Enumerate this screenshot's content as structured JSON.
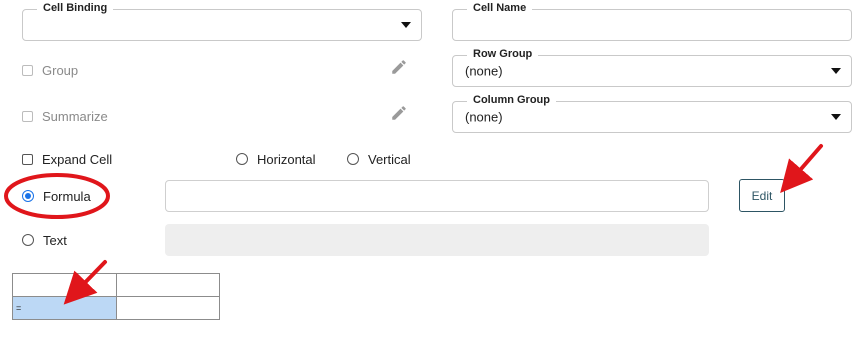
{
  "cell_binding": {
    "label": "Cell Binding",
    "value": ""
  },
  "cell_name": {
    "label": "Cell Name",
    "value": ""
  },
  "row_group": {
    "label": "Row Group",
    "value": "(none)"
  },
  "column_group": {
    "label": "Column Group",
    "value": "(none)"
  },
  "options": {
    "group_label": "Group",
    "summarize_label": "Summarize",
    "expand_cell_label": "Expand Cell",
    "horizontal_label": "Horizontal",
    "vertical_label": "Vertical"
  },
  "formula": {
    "label": "Formula",
    "value": "",
    "selected": true,
    "edit_label": "Edit"
  },
  "text": {
    "label": "Text",
    "value": ""
  },
  "mini_grid": {
    "rows": [
      [
        "",
        ""
      ],
      [
        "=",
        ""
      ]
    ],
    "selected_cell": "row 2, column 1"
  },
  "colors": {
    "accent": "#1a73e8",
    "annotation_red": "#e0161b",
    "selected_cell": "#bcd8f5",
    "edit_button": "#2d5564"
  },
  "icons": [
    "caret-down-icon",
    "pencil-icon",
    "arrow-annotation",
    "circle-annotation"
  ]
}
